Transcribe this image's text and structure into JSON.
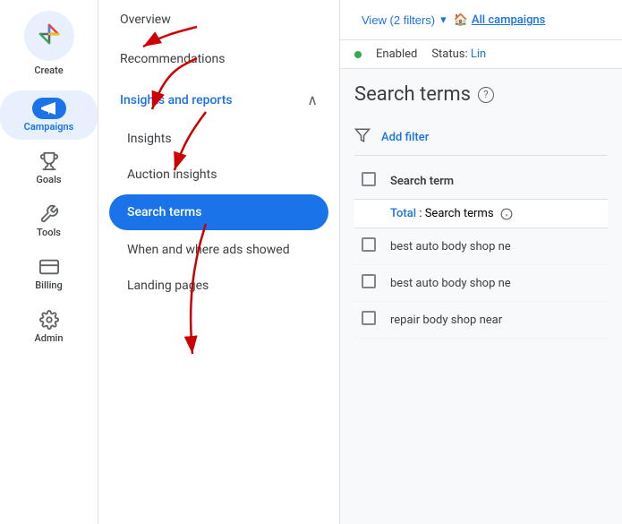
{
  "sidebar": {
    "create_label": "Create",
    "items": [
      {
        "id": "campaigns",
        "label": "Campaigns",
        "icon": "📣",
        "active": true
      },
      {
        "id": "goals",
        "label": "Goals",
        "icon": "🏆",
        "active": false
      },
      {
        "id": "tools",
        "label": "Tools",
        "icon": "🔧",
        "active": false
      },
      {
        "id": "billing",
        "label": "Billing",
        "icon": "💳",
        "active": false
      },
      {
        "id": "admin",
        "label": "Admin",
        "icon": "⚙️",
        "active": false
      }
    ]
  },
  "nav": {
    "items": [
      {
        "id": "overview",
        "label": "Overview",
        "level": "top"
      },
      {
        "id": "recommendations",
        "label": "Recommendations",
        "level": "top"
      },
      {
        "id": "insights-reports",
        "label": "Insights and reports",
        "level": "section",
        "expanded": true
      },
      {
        "id": "insights",
        "label": "Insights",
        "level": "sub"
      },
      {
        "id": "auction-insights",
        "label": "Auction insights",
        "level": "sub"
      },
      {
        "id": "search-terms",
        "label": "Search terms",
        "level": "sub",
        "active": true
      },
      {
        "id": "when-where",
        "label": "When and where ads showed",
        "level": "sub"
      },
      {
        "id": "landing-pages",
        "label": "Landing pages",
        "level": "sub"
      }
    ]
  },
  "topbar": {
    "view_label": "View (2 filters)",
    "all_campaigns_label": "All campaigns",
    "dropdown_icon": "▾"
  },
  "status": {
    "enabled_label": "Enabled",
    "status_label": "Status: ",
    "status_link": "Lin"
  },
  "search_terms_section": {
    "title": "Search terms",
    "help_icon": "?",
    "filter_label": "Add filter",
    "total_label": "Total",
    "colon_label": ":",
    "total_search_label": "Search terms",
    "column_header": "Search term",
    "rows": [
      {
        "id": 1,
        "text": "best auto body shop ne"
      },
      {
        "id": 2,
        "text": "best auto body shop ne"
      },
      {
        "id": 3,
        "text": "repair body shop near"
      }
    ]
  }
}
